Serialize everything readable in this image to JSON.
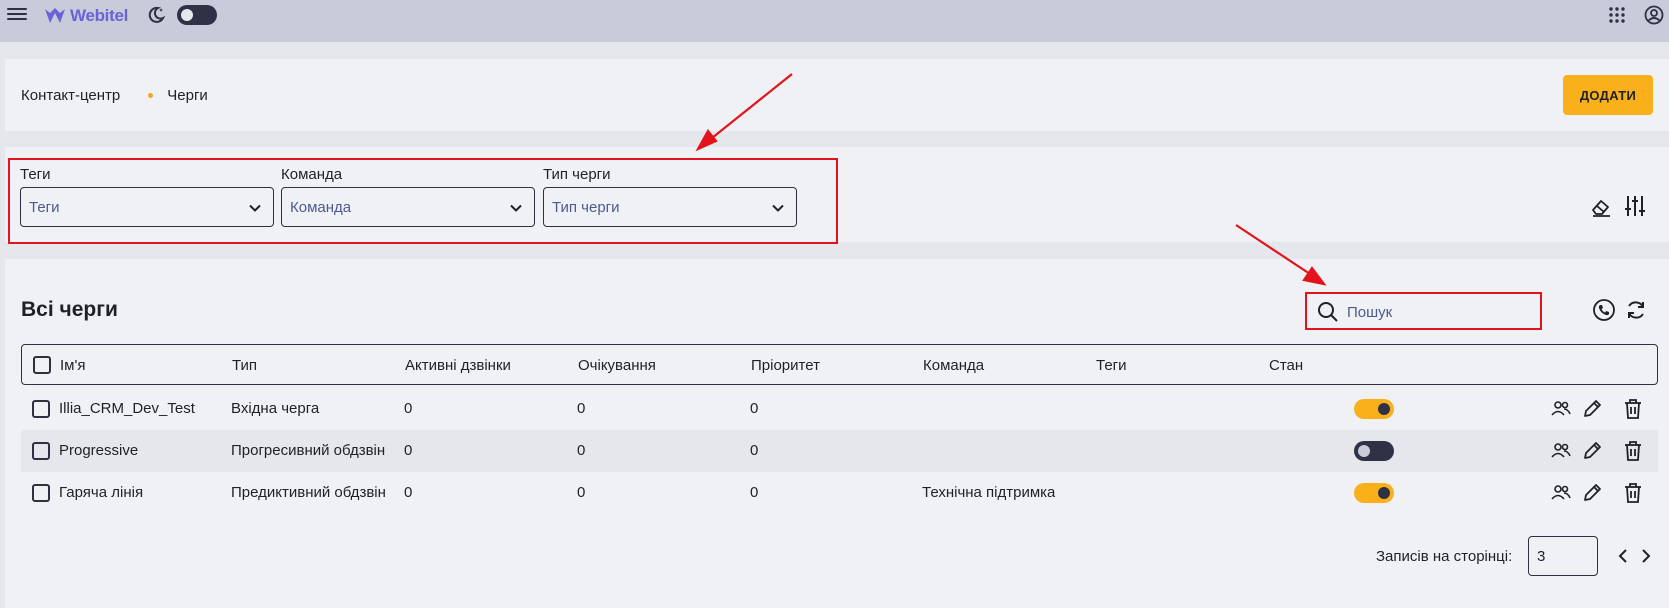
{
  "header": {
    "brand": "Webitel",
    "icons": [
      "menu-icon",
      "theme-moon-icon",
      "apps-grid-icon",
      "account-icon"
    ]
  },
  "breadcrumb": {
    "section": "Контакт-центр",
    "current": "Черги"
  },
  "actions": {
    "add_label": "ДОДАТИ"
  },
  "filters": [
    {
      "label": "Теги",
      "placeholder": "Теги"
    },
    {
      "label": "Команда",
      "placeholder": "Команда"
    },
    {
      "label": "Тип черги",
      "placeholder": "Тип черги"
    }
  ],
  "table": {
    "title": "Всі черги",
    "search_placeholder": "Пошук",
    "columns": [
      "Ім'я",
      "Тип",
      "Активні дзвінки",
      "Очікування",
      "Пріоритет",
      "Команда",
      "Теги",
      "Стан"
    ],
    "rows": [
      {
        "name": "Illia_CRM_Dev_Test",
        "type": "Вхідна черга",
        "active": "0",
        "waiting": "0",
        "priority": "0",
        "team": "",
        "tags": "",
        "enabled": true
      },
      {
        "name": "Progressive",
        "type": "Прогресивний обдзвін",
        "active": "0",
        "waiting": "0",
        "priority": "0",
        "team": "",
        "tags": "",
        "enabled": false
      },
      {
        "name": "Гаряча лінія",
        "type": "Предиктивний обдзвін",
        "active": "0",
        "waiting": "0",
        "priority": "0",
        "team": "Технічна підтримка",
        "tags": "",
        "enabled": true
      }
    ]
  },
  "pagination": {
    "label": "Записів на сторінці:",
    "page_size": "3"
  },
  "colors": {
    "accent": "#fab01a",
    "highlight": "#e2131c",
    "dark": "#2f3246",
    "brand": "#6b62d8"
  }
}
